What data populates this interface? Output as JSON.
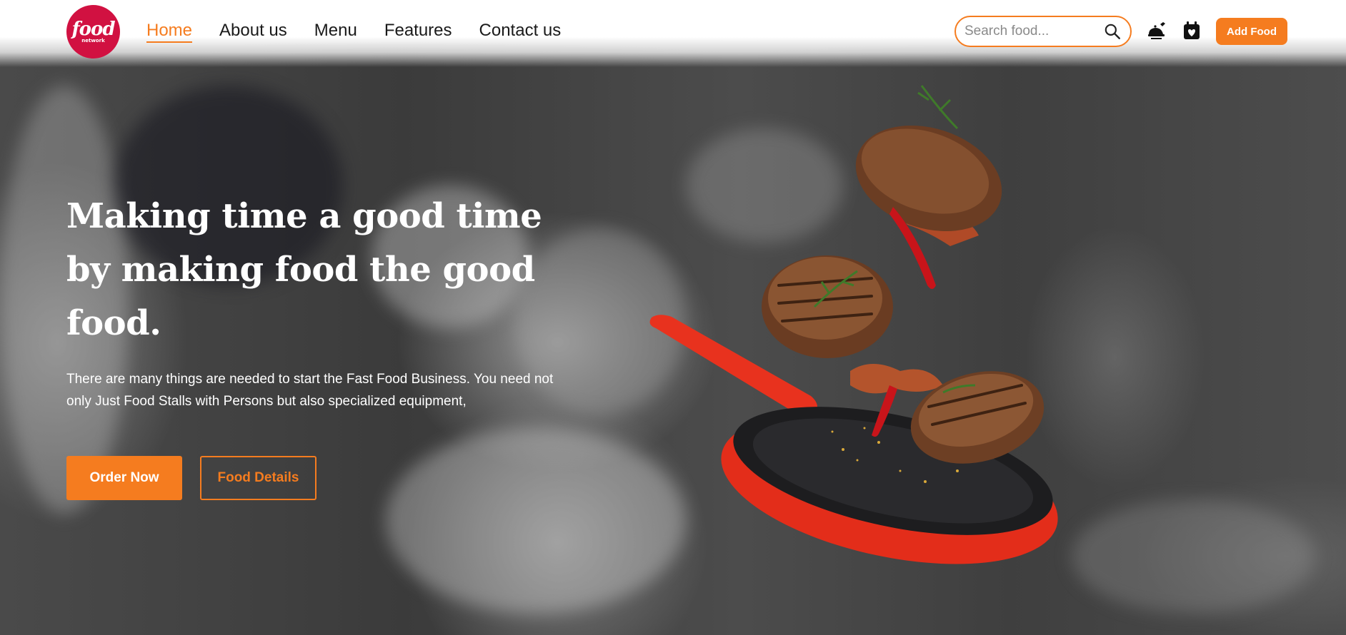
{
  "brand": {
    "logo_word": "food",
    "logo_sub": "network"
  },
  "nav": {
    "items": [
      {
        "label": "Home",
        "active": true
      },
      {
        "label": "About us",
        "active": false
      },
      {
        "label": "Menu",
        "active": false
      },
      {
        "label": "Features",
        "active": false
      },
      {
        "label": "Contact us",
        "active": false
      }
    ]
  },
  "search": {
    "placeholder": "Search food...",
    "value": ""
  },
  "header_actions": {
    "add_food_label": "Add Food",
    "icons": [
      "food-delivery-icon",
      "calendar-heart-icon"
    ]
  },
  "hero": {
    "title": "Making time a good time by making food the good food.",
    "description": "There are many things are needed to start the Fast Food Business. You need not only Just Food Stalls with Persons but also specialized equipment,",
    "primary_button": "Order Now",
    "secondary_button": "Food Details"
  },
  "colors": {
    "accent": "#f57c1f",
    "logo_red": "#d11141",
    "pan_red": "#e8321e",
    "text_dark": "#1a1a1a"
  }
}
